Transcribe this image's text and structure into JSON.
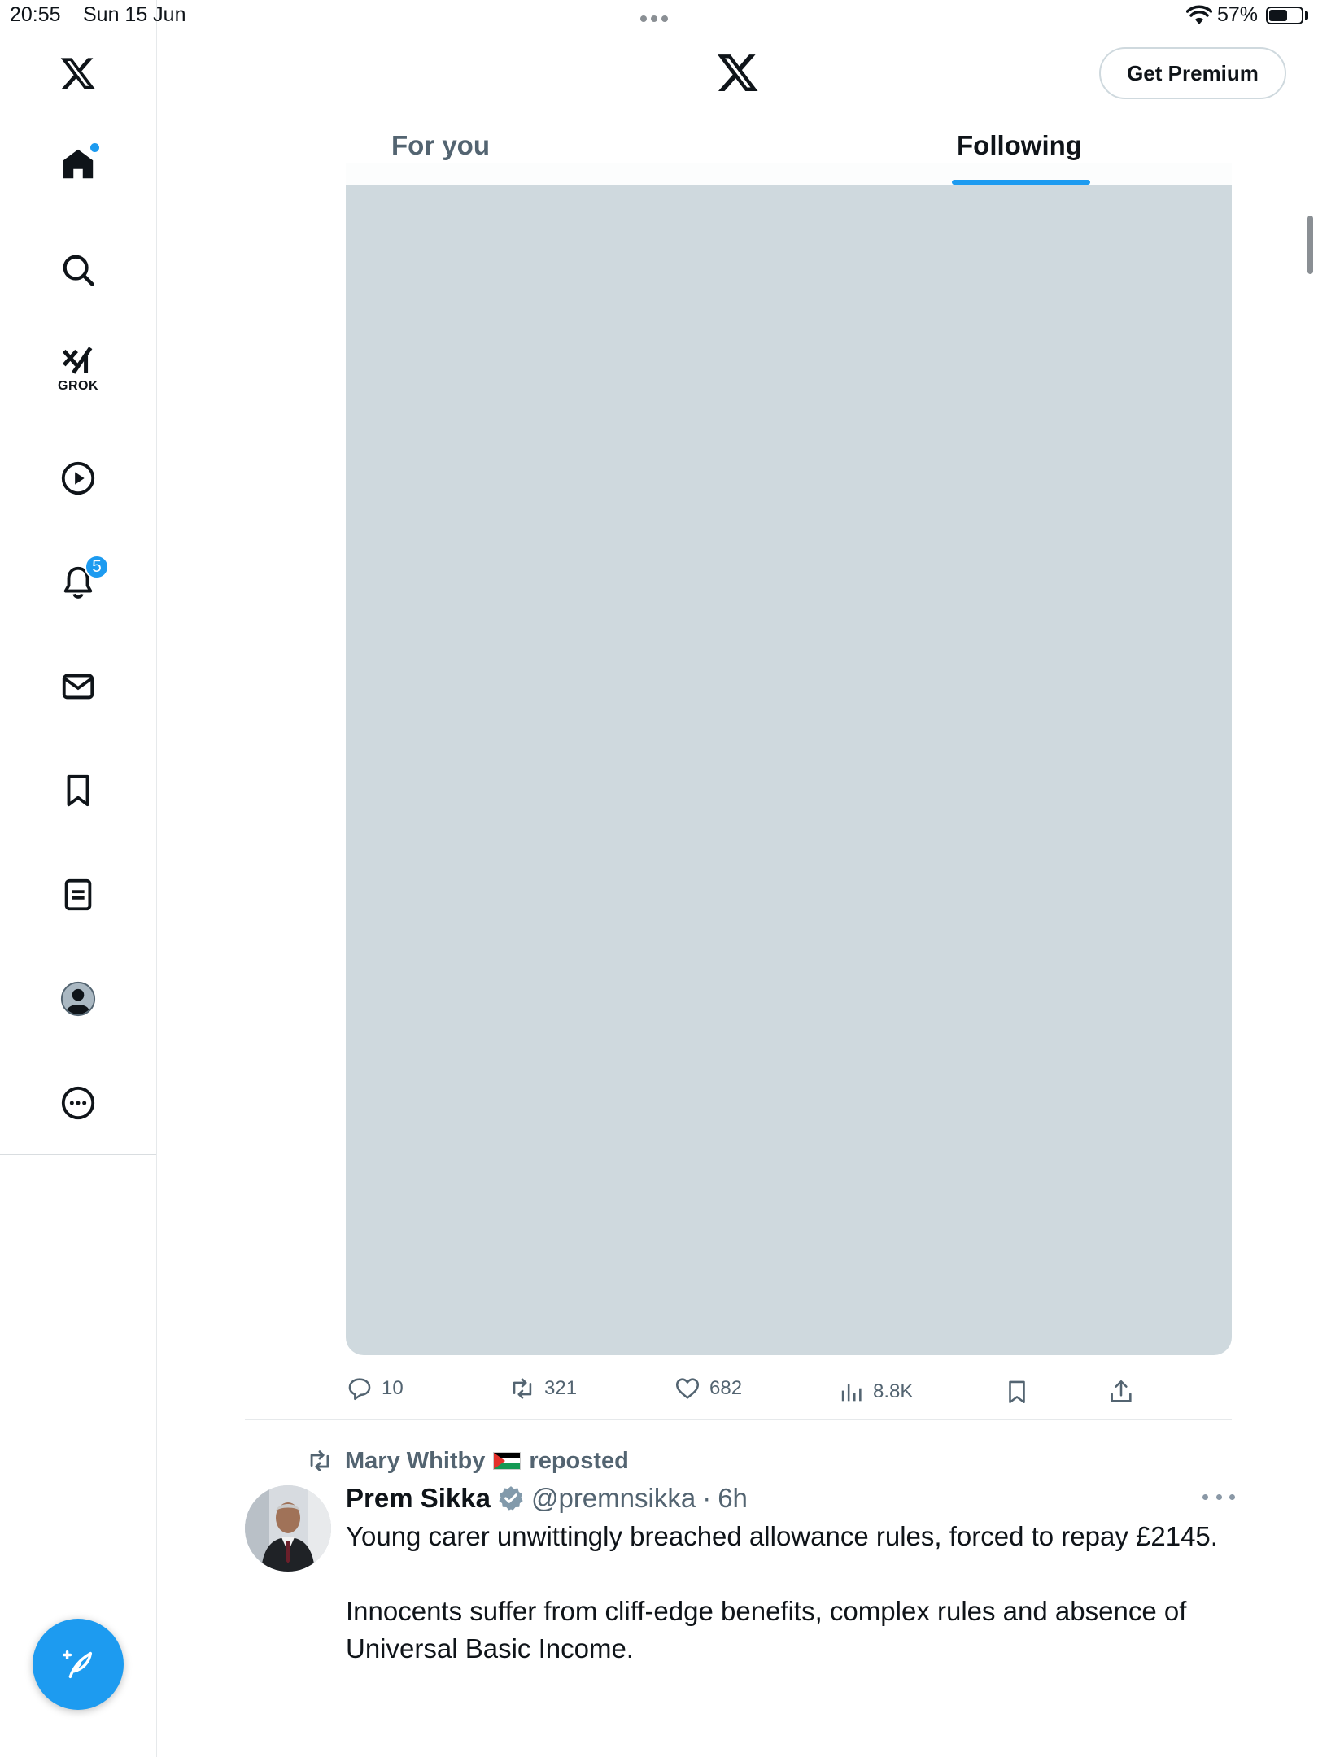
{
  "status_bar": {
    "time": "20:55",
    "date": "Sun 15 Jun",
    "battery_pct": "57%",
    "battery_level": 0.57
  },
  "sidebar": {
    "items": [
      {
        "name": "x-logo",
        "icon": "x-logo-icon"
      },
      {
        "name": "home",
        "icon": "home-icon",
        "has_dot": true
      },
      {
        "name": "explore",
        "icon": "search-icon"
      },
      {
        "name": "grok",
        "icon": "grok-icon",
        "label": "GROK"
      },
      {
        "name": "videos",
        "icon": "play-icon"
      },
      {
        "name": "notifications",
        "icon": "bell-icon",
        "badge": "5"
      },
      {
        "name": "messages",
        "icon": "mail-icon"
      },
      {
        "name": "bookmarks",
        "icon": "bookmark-icon"
      },
      {
        "name": "lists",
        "icon": "list-icon"
      },
      {
        "name": "profile",
        "icon": "avatar-icon"
      },
      {
        "name": "more",
        "icon": "more-icon"
      }
    ],
    "compose_icon": "compose-feather-icon"
  },
  "header": {
    "premium_label": "Get Premium",
    "tabs": [
      {
        "label": "For you",
        "active": false
      },
      {
        "label": "Following",
        "active": true
      }
    ]
  },
  "feed": {
    "post1_actions": {
      "replies": "10",
      "reposts": "321",
      "likes": "682",
      "views": "8.8K"
    },
    "post2": {
      "reposted_by": "Mary Whitby",
      "reposted_suffix": "reposted",
      "name": "Prem Sikka",
      "handle": "@premnsikka",
      "separator": "·",
      "time": "6h",
      "text_1": "Young carer unwittingly breached allowance rules, forced to repay £2145.",
      "text_2": "Innocents suffer from cliff-edge benefits, complex rules and absence of Universal Basic Income."
    }
  },
  "colors": {
    "accent": "#1d9bf0",
    "text": "#0f1419",
    "secondary": "#536471",
    "media_placeholder": "#cfd9de"
  }
}
